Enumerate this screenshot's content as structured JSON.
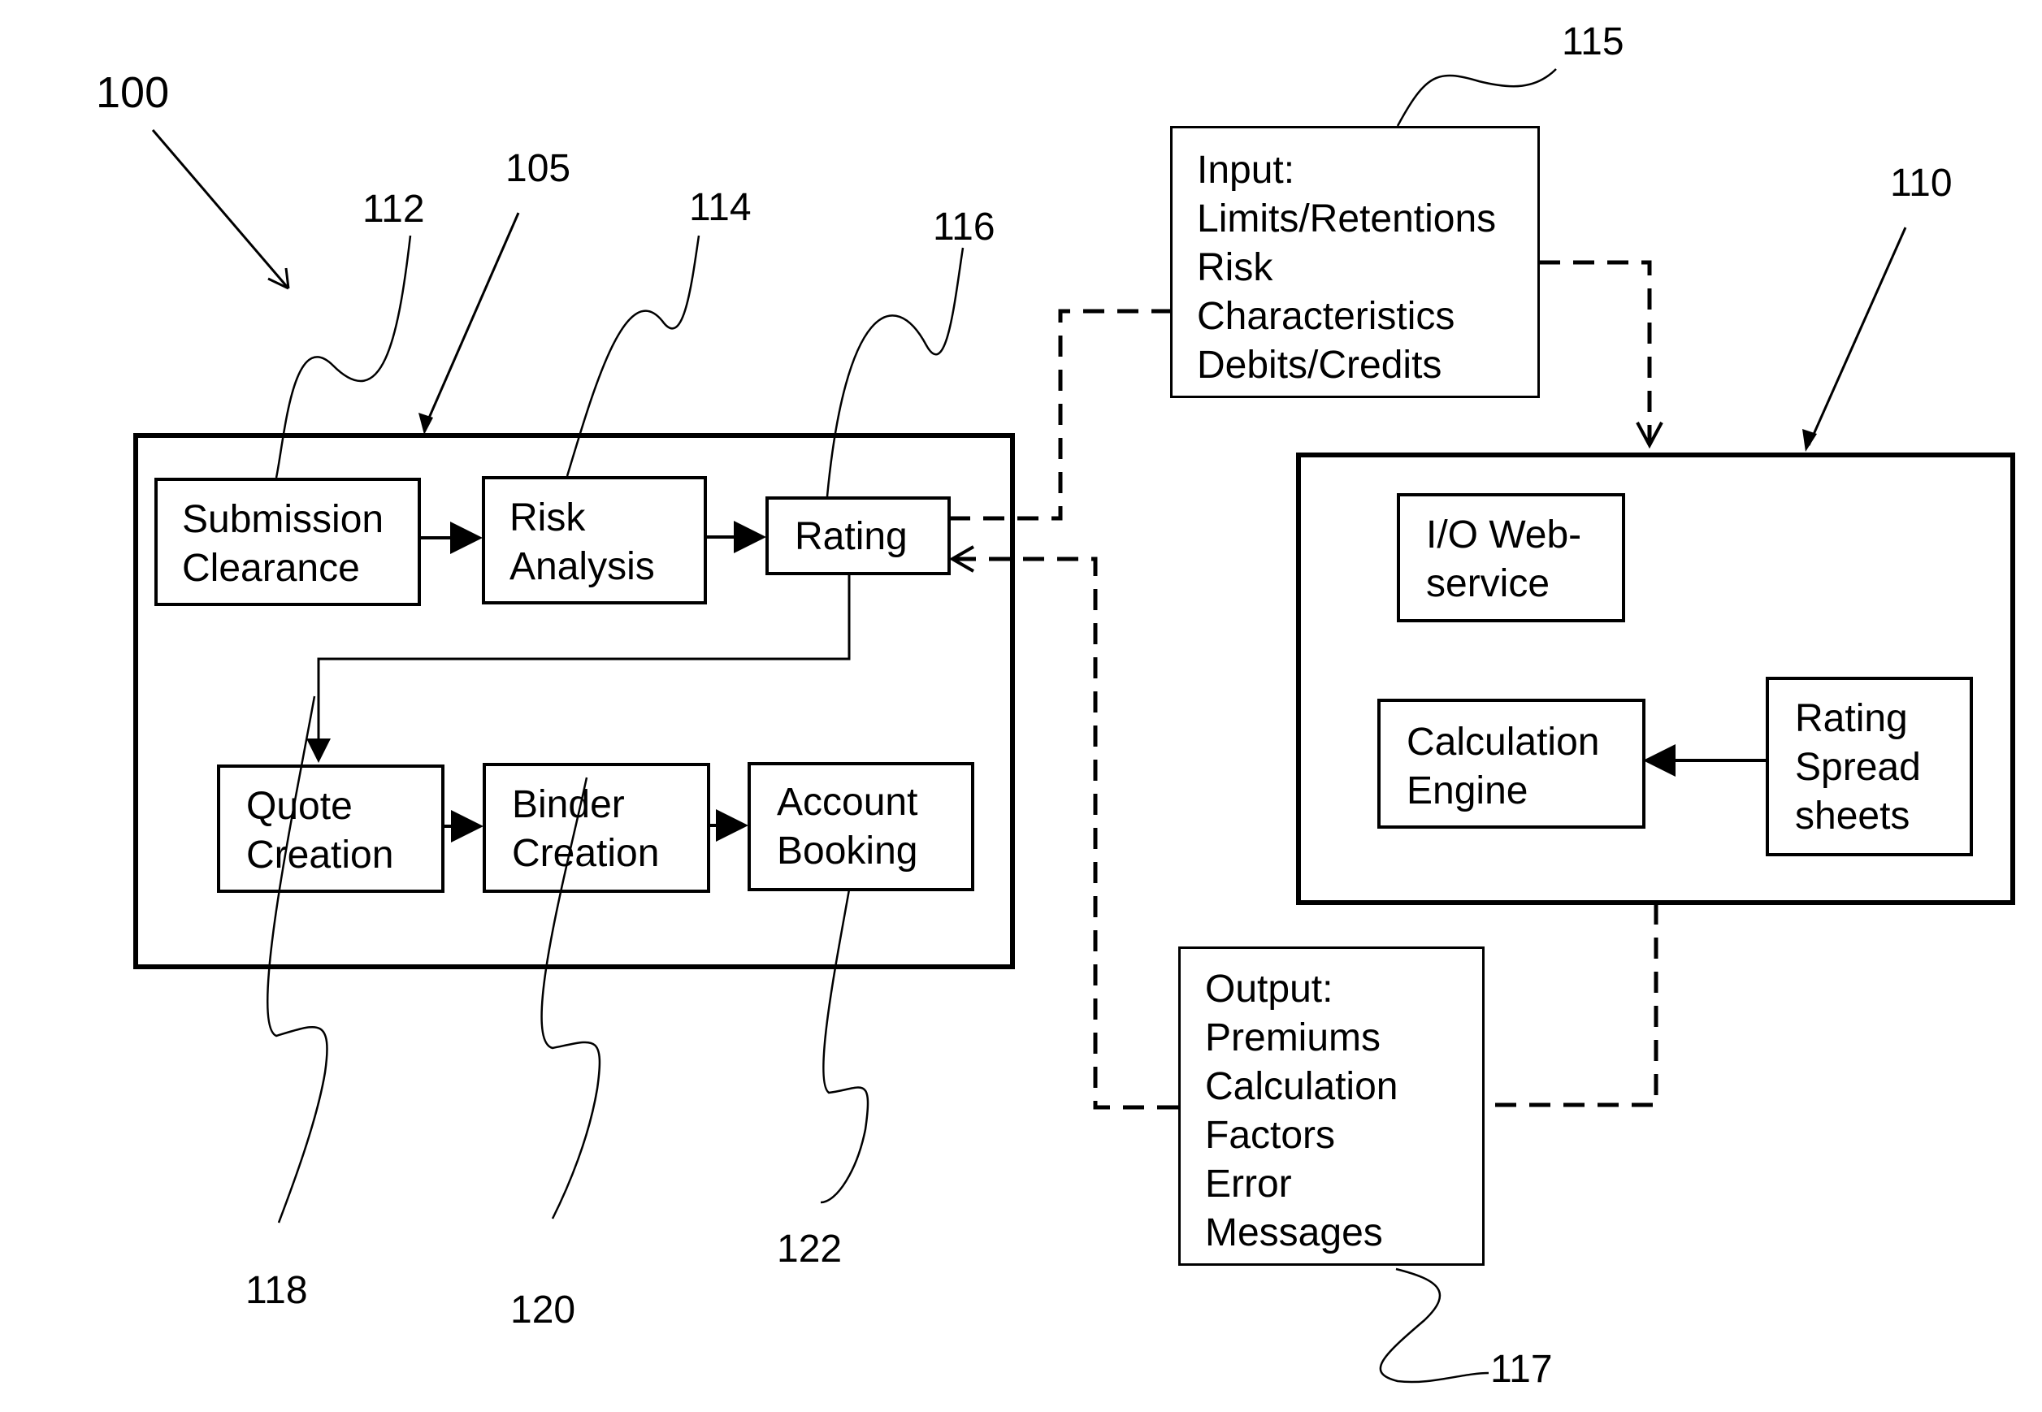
{
  "figure": {
    "reference": "100",
    "system_reference": "105",
    "engine_reference": "110"
  },
  "left_system": {
    "ref": "105",
    "components": [
      {
        "ref": "112",
        "lines": [
          "Submission",
          "Clearance"
        ]
      },
      {
        "ref": "114",
        "lines": [
          "Risk",
          "Analysis"
        ]
      },
      {
        "ref": "116",
        "lines": [
          "Rating"
        ]
      },
      {
        "ref": "118",
        "lines": [
          "Quote",
          "Creation"
        ]
      },
      {
        "ref": "120",
        "lines": [
          "Binder",
          "Creation"
        ]
      },
      {
        "ref": "122",
        "lines": [
          "Account",
          "Booking"
        ]
      }
    ]
  },
  "input_box": {
    "ref": "115",
    "lines": [
      "Input:",
      "Limits/Retentions",
      "Risk",
      "Characteristics",
      "Debits/Credits"
    ]
  },
  "right_system": {
    "ref": "110",
    "components": [
      {
        "lines": [
          "I/O Web-",
          "service"
        ]
      },
      {
        "lines": [
          "Calculation",
          "Engine"
        ]
      },
      {
        "lines": [
          "Rating",
          "Spread",
          "sheets"
        ]
      }
    ]
  },
  "output_box": {
    "ref": "117",
    "lines": [
      "Output:",
      "Premiums",
      "Calculation",
      "Factors",
      "Error",
      "Messages"
    ]
  }
}
